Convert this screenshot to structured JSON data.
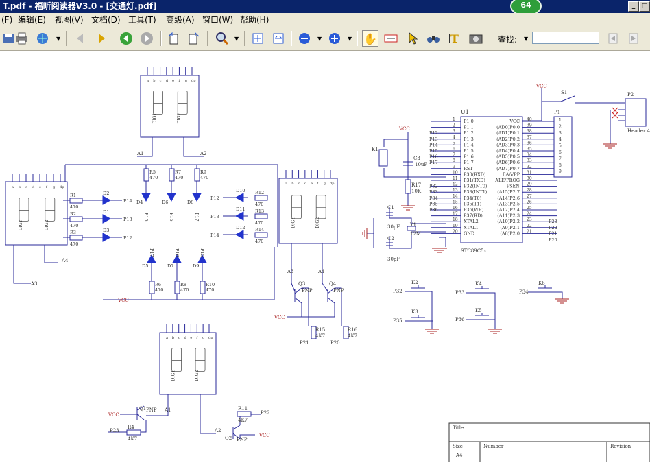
{
  "window": {
    "title": "T.pdf - 福昕阅读器V3.0 - [交通灯.pdf]",
    "badge": "64"
  },
  "menu": [
    {
      "label": "(F)"
    },
    {
      "label": "编辑(E)"
    },
    {
      "label": "视图(V)"
    },
    {
      "label": "文档(D)"
    },
    {
      "label": "工具(T)"
    },
    {
      "label": "高级(A)"
    },
    {
      "label": "窗口(W)"
    },
    {
      "label": "帮助(H)"
    }
  ],
  "toolbar": {
    "find_label": "查找:",
    "find_value": ""
  },
  "schematic": {
    "labels": {
      "vcc": "VCC",
      "gnd": "GND",
      "u1": "U1",
      "mcu": "STC89C5x",
      "s1": "S1",
      "p1": "P1",
      "p2": "P2",
      "header4": "Header 4",
      "k1": "K1",
      "k2": "K2",
      "k3": "K3",
      "k4": "K4",
      "k5": "K5",
      "k6": "K6",
      "c1": "C1",
      "c2": "C2",
      "c3": "C3",
      "y1": "Y1",
      "c1v": "30pF",
      "c2v": "30pF",
      "c3v": "10uF",
      "y1v": "12M",
      "r17": "R17",
      "r17v": "10K",
      "dig1": "DIG1",
      "dig2": "DIG2",
      "dp": "dp",
      "a1": "A1",
      "a2": "A2",
      "a3": "A3",
      "a4": "A4",
      "q1": "Q1",
      "q2": "Q2",
      "q3": "Q3",
      "q4": "Q4",
      "pnp": "PNP",
      "r4": "R4",
      "r11": "R11",
      "r15": "R15",
      "r16": "R16",
      "r4k7": "4K7",
      "p20": "P20",
      "p21": "P21",
      "p22": "P22",
      "p23": "P23",
      "p32": "P32",
      "p33": "P33",
      "p34": "P34",
      "p35": "P35",
      "p36": "P36",
      "title": "Title",
      "size": "Size",
      "sizev": "A4",
      "number": "Number",
      "revision": "Revision"
    },
    "mcu_left_pins": [
      {
        "num": "1",
        "name": "P1.0",
        "net": ""
      },
      {
        "num": "2",
        "name": "P1.1",
        "net": ""
      },
      {
        "num": "3",
        "name": "P1.2",
        "net": "P12"
      },
      {
        "num": "4",
        "name": "P1.3",
        "net": "P13"
      },
      {
        "num": "5",
        "name": "P1.4",
        "net": "P14"
      },
      {
        "num": "6",
        "name": "P1.5",
        "net": "P15"
      },
      {
        "num": "7",
        "name": "P1.6",
        "net": "P16"
      },
      {
        "num": "8",
        "name": "P1.7",
        "net": "P17"
      },
      {
        "num": "9",
        "name": "RST",
        "net": ""
      },
      {
        "num": "10",
        "name": "P30(RXD)",
        "net": ""
      },
      {
        "num": "11",
        "name": "P31(TXD)",
        "net": ""
      },
      {
        "num": "12",
        "name": "P32(INT0)",
        "net": "P32"
      },
      {
        "num": "13",
        "name": "P33(INT1)",
        "net": "P33"
      },
      {
        "num": "14",
        "name": "P34(T0)",
        "net": "P34"
      },
      {
        "num": "15",
        "name": "P35(T1)",
        "net": "P35"
      },
      {
        "num": "16",
        "name": "P36(WR)",
        "net": "P36"
      },
      {
        "num": "17",
        "name": "P37(RD)",
        "net": ""
      },
      {
        "num": "18",
        "name": "XTAL2",
        "net": ""
      },
      {
        "num": "19",
        "name": "XTAL1",
        "net": ""
      },
      {
        "num": "20",
        "name": "GND",
        "net": ""
      }
    ],
    "mcu_right_pins": [
      {
        "num": "40",
        "name": "VCC",
        "net": ""
      },
      {
        "num": "39",
        "name": "(AD0)P0.0",
        "net": ""
      },
      {
        "num": "38",
        "name": "(AD1)P0.1",
        "net": ""
      },
      {
        "num": "37",
        "name": "(AD2)P0.2",
        "net": ""
      },
      {
        "num": "36",
        "name": "(AD3)P0.3",
        "net": ""
      },
      {
        "num": "35",
        "name": "(AD4)P0.4",
        "net": ""
      },
      {
        "num": "34",
        "name": "(AD5)P0.5",
        "net": ""
      },
      {
        "num": "33",
        "name": "(AD6)P0.6",
        "net": ""
      },
      {
        "num": "32",
        "name": "(AD7)P0.7",
        "net": ""
      },
      {
        "num": "31",
        "name": "EA/VPP",
        "net": ""
      },
      {
        "num": "30",
        "name": "ALE/PROG",
        "net": ""
      },
      {
        "num": "29",
        "name": "PSEN",
        "net": ""
      },
      {
        "num": "28",
        "name": "(A15)P2.7",
        "net": ""
      },
      {
        "num": "27",
        "name": "(A14)P2.6",
        "net": ""
      },
      {
        "num": "26",
        "name": "(A13)P2.5",
        "net": ""
      },
      {
        "num": "25",
        "name": "(A12)P2.4",
        "net": ""
      },
      {
        "num": "24",
        "name": "(A11)P2.3",
        "net": ""
      },
      {
        "num": "23",
        "name": "(A10)P2.2",
        "net": "P23"
      },
      {
        "num": "22",
        "name": "(A9)P2.1",
        "net": "P22"
      },
      {
        "num": "21",
        "name": "(A8)P2.0",
        "net": "P21"
      }
    ],
    "p20_net": "P20",
    "display_pins": [
      "a",
      "b",
      "c",
      "d",
      "e",
      "f",
      "g",
      "dp"
    ],
    "left_leds": [
      {
        "r": "R1",
        "rv": "470",
        "d": "D2",
        "net": "P14"
      },
      {
        "r": "R2",
        "rv": "470",
        "d": "D1",
        "net": "P13"
      },
      {
        "r": "R3",
        "rv": "470",
        "d": "D3",
        "net": "P12"
      }
    ],
    "right_leds": [
      {
        "r": "R12",
        "rv": "470",
        "d": "D10",
        "net": "P12"
      },
      {
        "r": "R13",
        "rv": "470",
        "d": "D11",
        "net": "P13"
      },
      {
        "r": "R14",
        "rv": "470",
        "d": "D12",
        "net": "P14"
      }
    ],
    "top_leds": [
      {
        "r": "R5",
        "rv": "470",
        "d": "D4",
        "net": "P15"
      },
      {
        "r": "R7",
        "rv": "470",
        "d": "D6",
        "net": "P16"
      },
      {
        "r": "R9",
        "rv": "470",
        "d": "D8",
        "net": "P17"
      }
    ],
    "bottom_leds": [
      {
        "r": "R6",
        "rv": "470",
        "d": "D5",
        "net": "P17"
      },
      {
        "r": "R8",
        "rv": "470",
        "d": "D7",
        "net": "P16"
      },
      {
        "r": "R10",
        "rv": "470",
        "d": "D9",
        "net": "P15"
      }
    ]
  }
}
